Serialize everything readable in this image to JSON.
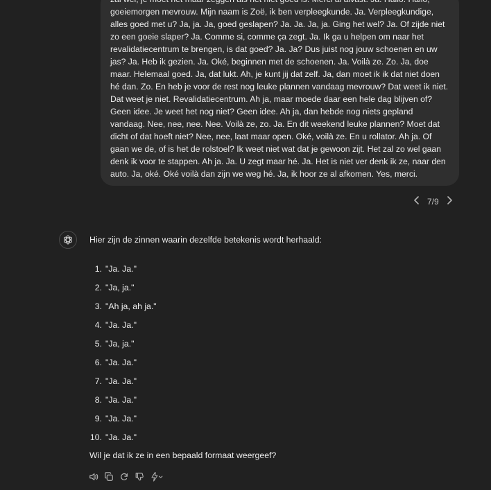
{
  "user_message": {
    "text": "zal wel, je moet het maar zeggen als het niet goed is. Merci al alvast. Ja. Hallo. Hallo, goeiemorgen mevrouw. Mijn naam is Zoë, ik ben verpleegkunde.  Ja. Verpleegkundige, alles goed met u? Ja, ja. Ja, goed geslapen? Ja. Ja. Ja, ja. Ging het wel? Ja. Of zijde niet zo een goeie slaper? Ja.  Comme si, comme ça zegt. Ja. Ik ga u helpen om naar het revalidatiecentrum te brengen, is dat goed?  Ja. Ja? Dus juist nog jouw schoenen en uw jas? Ja. Heb ik gezien. Ja. Oké, beginnen met de schoenen.  Ja. Voilà ze. Zo. Ja, doe maar. Helemaal goed.  Ja, dat lukt. Ah, je kunt jij dat zelf. Ja, dan moet ik ik dat niet doen hé dan. Zo. En heb je voor de rest nog leuke plannen vandaag mevrouw? Dat weet ik niet. Dat weet je niet. Revalidatiecentrum. Ah ja, maar moede daar een hele dag blijven of? Geen idee. Je weet het nog niet? Geen idee. Ah ja, dan hebde nog niets gepland vandaag. Nee, nee, nee. Nee. Voilà ze, zo. Ja. En dit weekend leuke plannen? Moet dat dicht of dat hoeft niet? Nee, nee, laat maar open. Oké, voilà ze. En u rollator. Ah ja. Of gaan we de, of is het de rolstoel? Ik weet niet wat dat je gewoon zijt. Het zal zo wel gaan denk ik voor te stappen. Ah ja. Ja. U zegt maar hé. Ja. Het is niet ver denk ik ze, naar den auto. Ja, oké. Oké voilà dan zijn we weg hé. Ja, ik hoor ze al afkomen. Yes, merci."
  },
  "pager": {
    "prev_icon": "chevron-left-icon",
    "label": "7/9",
    "next_icon": "chevron-right-icon"
  },
  "assistant": {
    "avatar_icon": "openai-logo-icon",
    "intro": "Hier zijn de zinnen waarin dezelfde betekenis wordt herhaald:",
    "items": [
      {
        "num": "1.",
        "text": "\"Ja. Ja.\""
      },
      {
        "num": "2.",
        "text": "\"Ja, ja.\""
      },
      {
        "num": "3.",
        "text": "\"Ah ja, ah ja.\""
      },
      {
        "num": "4.",
        "text": "\"Ja. Ja.\""
      },
      {
        "num": "5.",
        "text": "\"Ja, ja.\""
      },
      {
        "num": "6.",
        "text": "\"Ja. Ja.\""
      },
      {
        "num": "7.",
        "text": "\"Ja. Ja.\""
      },
      {
        "num": "8.",
        "text": "\"Ja. Ja.\""
      },
      {
        "num": "9.",
        "text": "\"Ja. Ja.\""
      },
      {
        "num": "10.",
        "text": "\"Ja. Ja.\""
      }
    ],
    "closing": "Wil je dat ik ze in een bepaald formaat weergeef?"
  },
  "actions": [
    "speaker-icon",
    "copy-icon",
    "regenerate-icon",
    "thumbs-down-icon",
    "model-switch-icon"
  ],
  "colors": {
    "background": "#212121",
    "user_bubble": "#2f2f2f",
    "text": "#ececec",
    "muted": "#b4b4b4"
  }
}
